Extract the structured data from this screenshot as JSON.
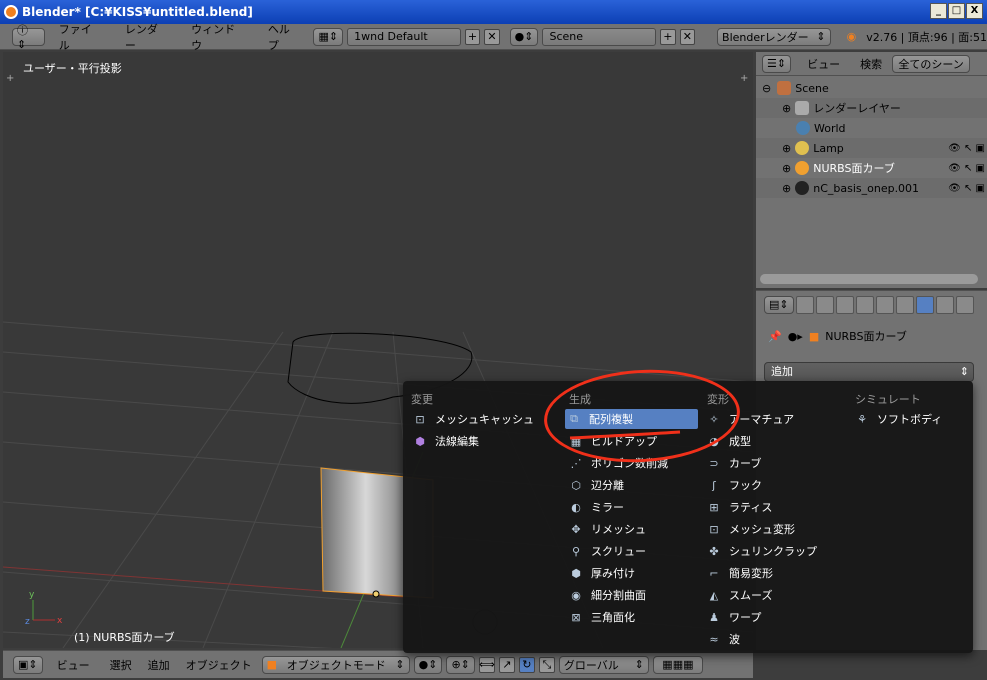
{
  "window": {
    "title": "Blender* [C:¥KISS¥untitled.blend]",
    "min": "_",
    "max": "□",
    "close": "X"
  },
  "info": {
    "menus": [
      "ファイル",
      "レンダー",
      "ウィンドウ",
      "ヘルプ"
    ],
    "layout": "1wnd Default",
    "scene": "Scene",
    "engine": "Blenderレンダー",
    "stats": "v2.76 | 頂点:96 | 面:51"
  },
  "viewport": {
    "view_label": "ユーザー・平行投影",
    "object_label": "(1) NURBS面カーブ"
  },
  "vp_footer": {
    "menus": [
      "ビュー",
      "選択",
      "追加",
      "オブジェクト"
    ],
    "mode": "オブジェクトモード",
    "orientation": "グローバル"
  },
  "outliner": {
    "view": "ビュー",
    "search": "検索",
    "filter": "全てのシーン",
    "rows": [
      "Scene",
      "レンダーレイヤー",
      "World",
      "Lamp",
      "NURBS面カーブ",
      "nC_basis_onep.001"
    ]
  },
  "properties": {
    "object": "NURBS面カーブ",
    "add_modifier": "追加"
  },
  "menu": {
    "col1": {
      "header": "変更",
      "items": [
        "メッシュキャッシュ",
        "法線編集"
      ]
    },
    "col2": {
      "header": "生成",
      "items": [
        "配列複製",
        "ビルドアップ",
        "ポリゴン数削減",
        "辺分離",
        "ミラー",
        "リメッシュ",
        "スクリュー",
        "厚み付け",
        "細分割曲面",
        "三角面化"
      ]
    },
    "col3": {
      "header": "変形",
      "items": [
        "アーマチュア",
        "成型",
        "カーブ",
        "フック",
        "ラティス",
        "メッシュ変形",
        "シュリンクラップ",
        "簡易変形",
        "スムーズ",
        "ワープ",
        "波"
      ]
    },
    "col4": {
      "header": "シミュレート",
      "items": [
        "ソフトボディ"
      ]
    }
  },
  "colors": {
    "highlight": "#5680c2",
    "annotation": "#f0301a",
    "selected_outline": "#f0a030"
  }
}
